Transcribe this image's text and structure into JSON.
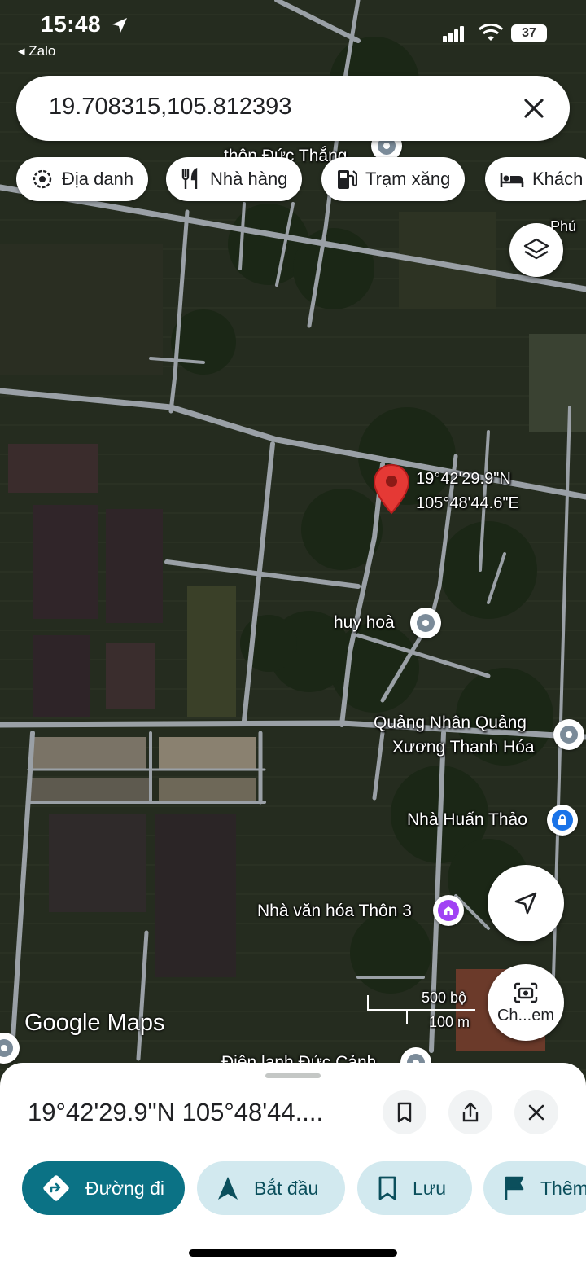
{
  "status_bar": {
    "time": "15:48",
    "back_app": "◂ Zalo",
    "battery": "37"
  },
  "search": {
    "query": "19.708315,105.812393"
  },
  "chips": [
    {
      "label": "Địa danh",
      "icon": "landmark-icon"
    },
    {
      "label": "Nhà hàng",
      "icon": "restaurant-icon"
    },
    {
      "label": "Trạm xăng",
      "icon": "gas-station-icon"
    },
    {
      "label": "Khách",
      "icon": "hotel-icon"
    }
  ],
  "map": {
    "pin_label_lat": "19°42'29.9\"N",
    "pin_label_lng": "105°48'44.6\"E",
    "places": {
      "top": "thôn Đức Thắng",
      "huy_hoa": "huy hoà",
      "quang_nhan_1": "Quảng Nhân Quảng",
      "quang_nhan_2": "Xương Thanh Hóa",
      "nha_huan_thao": "Nhà Huấn Thảo",
      "nha_van_hoa": "Nhà văn hóa Thôn 3",
      "bottom": "Điện lạnh Đức Cảnh",
      "top_right": "Phú"
    },
    "scale_top": "500 bộ",
    "scale_bottom": "100 m",
    "logo": "Google Maps",
    "camera_label": "Ch...em"
  },
  "sheet": {
    "title": "19°42'29.9\"N 105°48'44....",
    "actions": [
      {
        "label": "Đường đi",
        "icon": "directions-icon"
      },
      {
        "label": "Bắt đầu",
        "icon": "navigation-arrow-icon"
      },
      {
        "label": "Lưu",
        "icon": "bookmark-icon"
      },
      {
        "label": "Thêm",
        "icon": "flag-icon"
      }
    ]
  },
  "colors": {
    "pin_red": "#e53935",
    "primary_teal": "#0b7285",
    "chip_bg": "#d3e3fd",
    "chip_text": "#0b57d0"
  }
}
